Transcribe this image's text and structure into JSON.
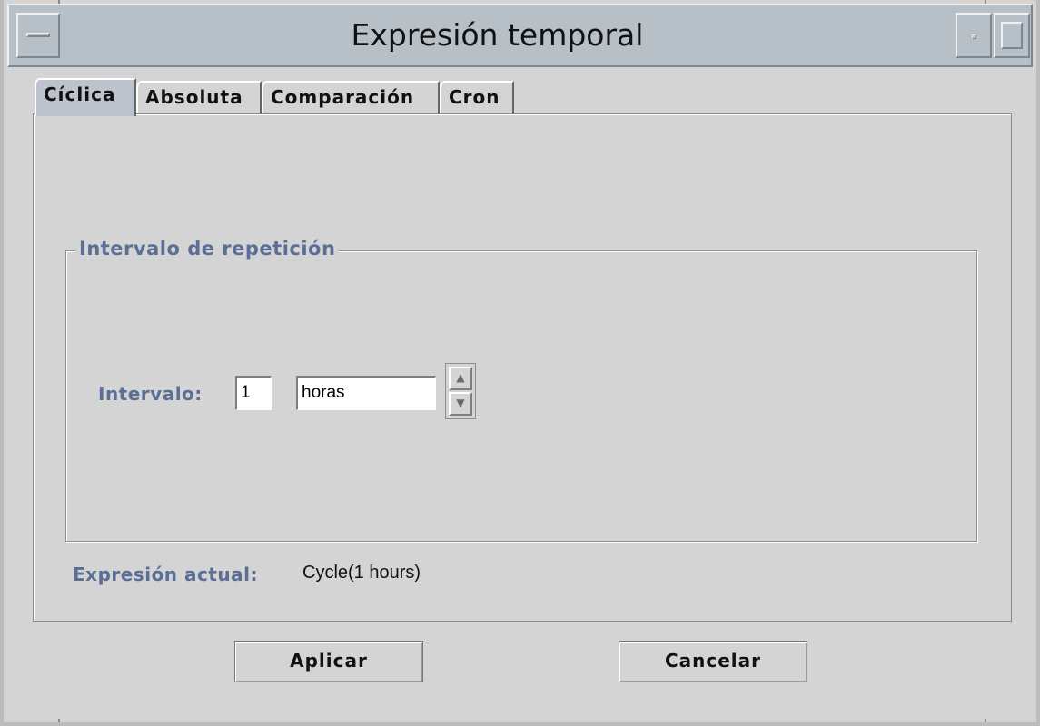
{
  "window": {
    "title": "Expresión temporal"
  },
  "tabs": [
    {
      "label": "Cíclica",
      "active": true
    },
    {
      "label": "Absoluta",
      "active": false
    },
    {
      "label": "Comparación",
      "active": false
    },
    {
      "label": "Cron",
      "active": false
    }
  ],
  "group": {
    "title": "Intervalo de repetición",
    "interval_label": "Intervalo:",
    "interval_value": "1",
    "unit_value": "horas"
  },
  "current": {
    "label": "Expresión actual:",
    "value": "Cycle(1 hours)"
  },
  "buttons": {
    "apply": "Aplicar",
    "cancel": "Cancelar"
  },
  "icons": {
    "spin_up": "arrow-up-icon",
    "spin_down": "arrow-down-icon",
    "window_menu": "window-menu-icon",
    "minimize": "minimize-icon",
    "maximize": "maximize-icon"
  },
  "colors": {
    "label_accent": "#5a6e96",
    "titlebar": "#b7bfc7",
    "background": "#d4d4d4"
  }
}
